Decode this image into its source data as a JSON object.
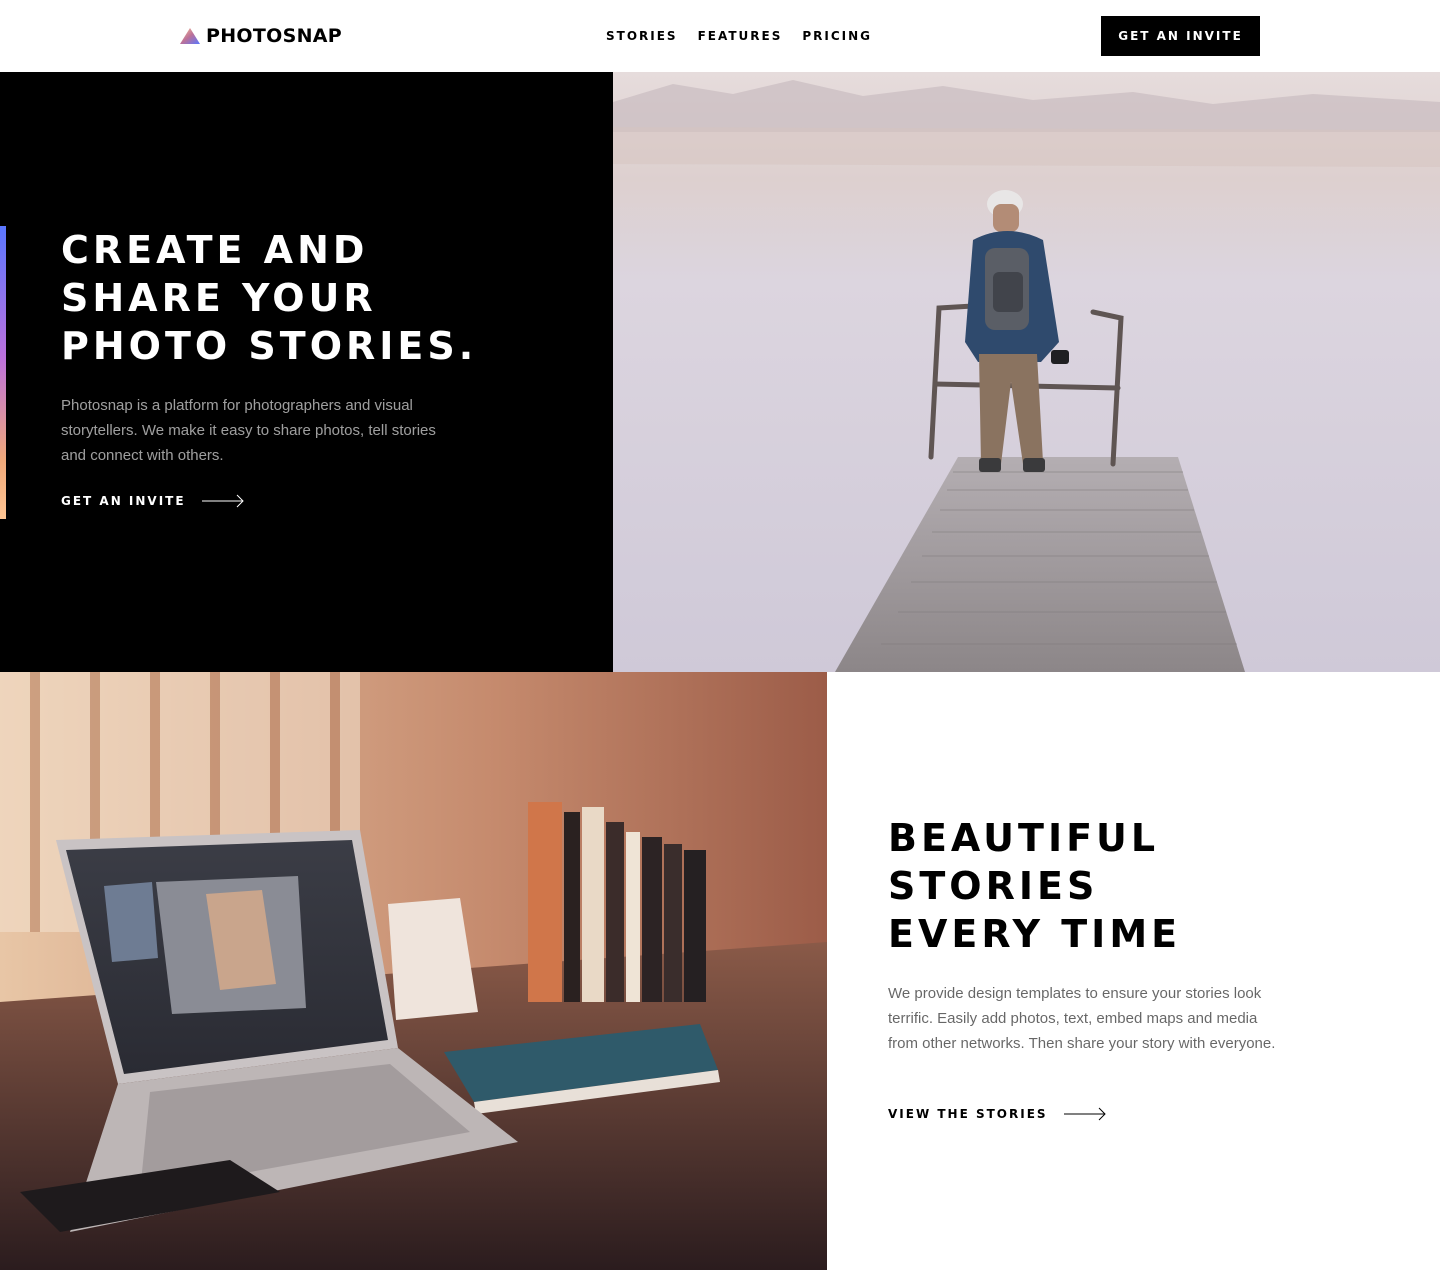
{
  "header": {
    "logo_text": "PHOTOSNAP",
    "logo_icon": "triangle-logo-icon",
    "nav": [
      "STORIES",
      "FEATURES",
      "PRICING"
    ],
    "cta_label": "GET AN INVITE"
  },
  "hero": {
    "title_lines": [
      "CREATE AND",
      "SHARE YOUR",
      "PHOTO STORIES."
    ],
    "text": "Photosnap is a platform for photographers and visual storytellers. We make it easy to share photos, tell stories and connect with others.",
    "link_label": "GET AN INVITE",
    "link_icon": "arrow-right-icon",
    "photo": "photo-man-on-pier-by-lake",
    "background": "#000000",
    "accent_gradient": [
      "#5a77ff",
      "#bc71dc",
      "#ffc593"
    ]
  },
  "feature": {
    "title_lines": [
      "BEAUTIFUL",
      "STORIES",
      "EVERY TIME"
    ],
    "text": "We provide design templates to ensure your stories look terrific. Easily add photos, text, embed maps and media from other networks. Then share your story with everyone.",
    "link_label": "VIEW THE STORIES",
    "link_icon": "arrow-right-icon",
    "photo": "photo-laptop-on-desk-with-books"
  }
}
